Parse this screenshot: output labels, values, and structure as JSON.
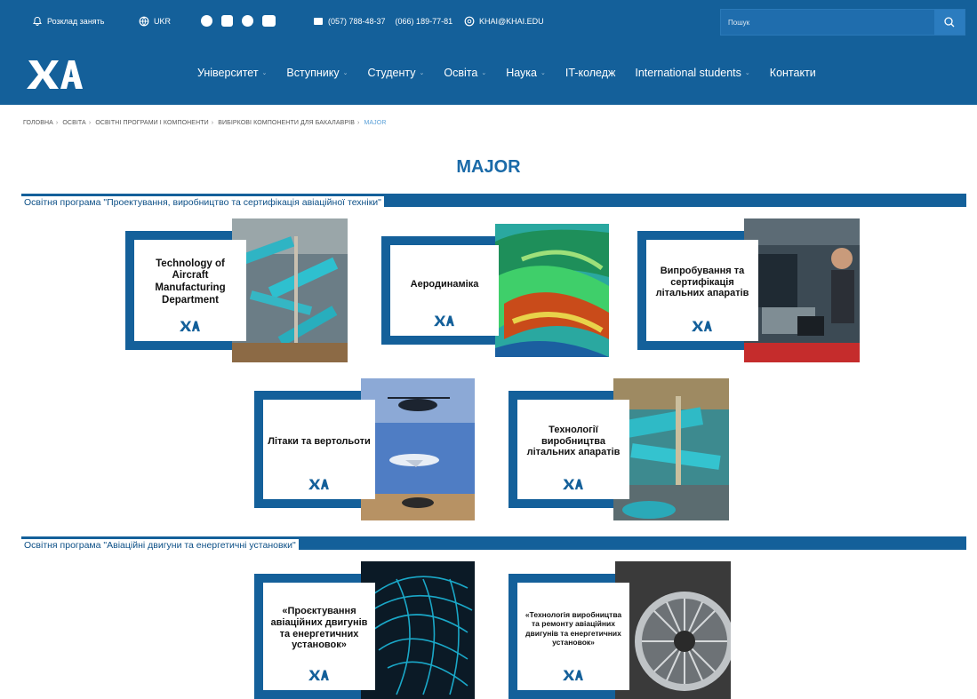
{
  "topbar": {
    "schedule": "Розклад занять",
    "lang": "UKR",
    "phone1": "(057) 788-48-37",
    "phone2": "(066) 189-77-81",
    "email": "KHAI@KHAI.EDU",
    "search_placeholder": "Пошук"
  },
  "nav": {
    "logo": "ХАІ",
    "items": [
      "Університет",
      "Вступнику",
      "Студенту",
      "Освіта",
      "Наука",
      "IT-коледж",
      "International students",
      "Контакти"
    ]
  },
  "breadcrumb": [
    "ГОЛОВНА",
    "ОСВІТА",
    "ОСВІТНІ ПРОГРАМИ І КОМПОНЕНТИ",
    "ВИБІРКОВІ КОМПОНЕНТИ ДЛЯ БАКАЛАВРІВ",
    "MAJOR"
  ],
  "page_title": "MAJOR",
  "sections": [
    {
      "title": "Освітня програма \"Проектування, виробництво та сертифікація авіаційної техніки\"",
      "cards": [
        {
          "title": "Technology of Aircraft Manufacturing Department"
        },
        {
          "title": "Аеродинаміка"
        },
        {
          "title": "Випробування та сертифікація літальних апаратів"
        },
        {
          "title": "Літаки та вертольоти"
        },
        {
          "title": "Технології виробництва літальних апаратів"
        }
      ]
    },
    {
      "title": "Освітня програма \"Авіаційні двигуни та енергетичні установки\"",
      "cards": [
        {
          "title": "«Проєктування авіаційних двигунів та енергетичних установок»"
        },
        {
          "title": "«Технологія виробництва та ремонту авіаційних двигунів та енергетичних установок»"
        }
      ]
    }
  ],
  "colors": {
    "primary": "#14609a",
    "title": "#1a6aa8"
  }
}
